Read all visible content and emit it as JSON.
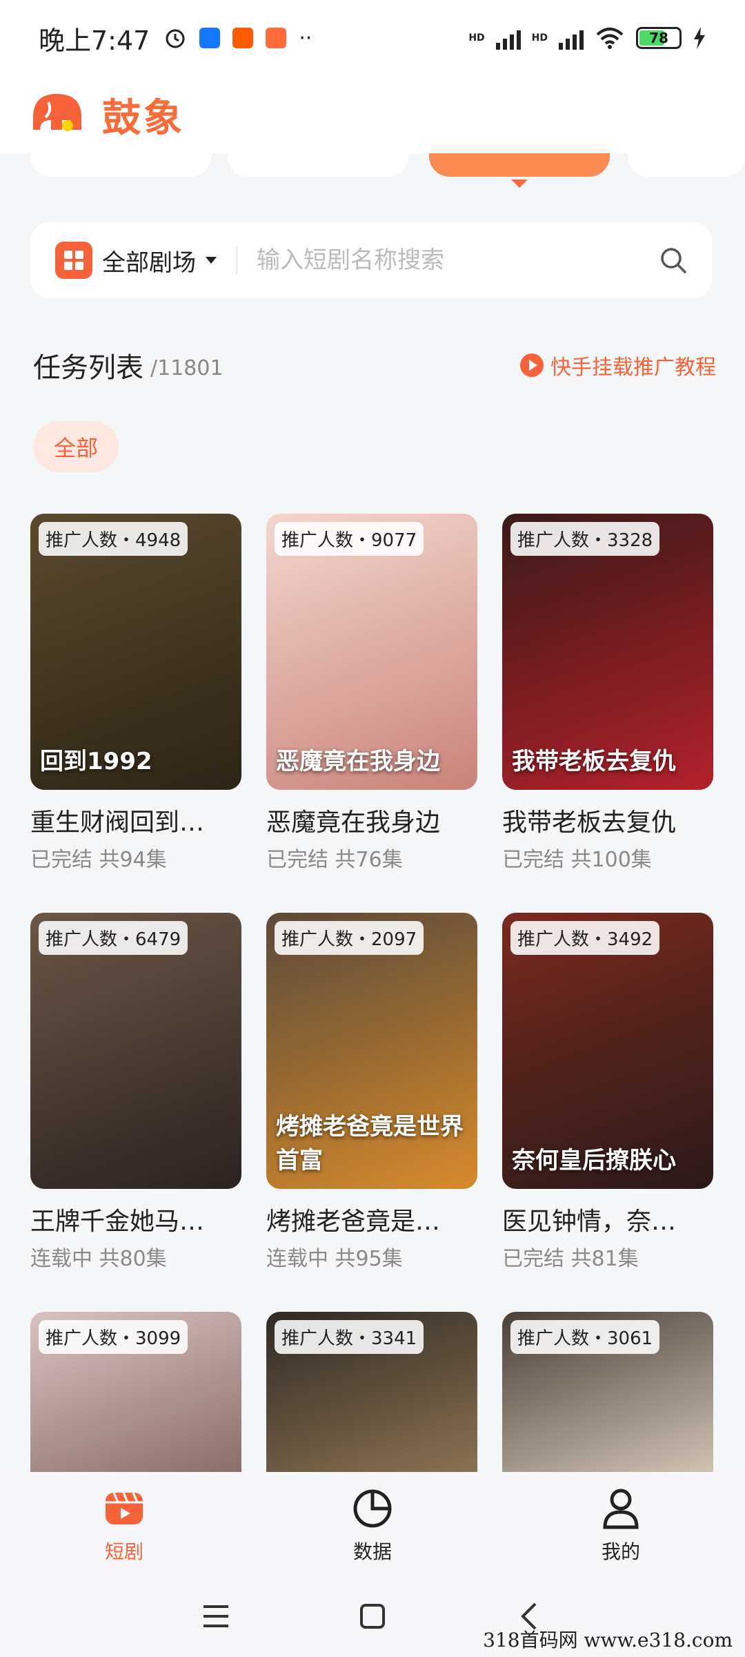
{
  "status_bar": {
    "time": "晚上7:47",
    "battery": "78",
    "net_1": "HD",
    "net_2": "HD"
  },
  "app": {
    "name": "鼓象",
    "accent": "#f6623a"
  },
  "search": {
    "theater_label": "全部剧场",
    "placeholder": "输入短剧名称搜索"
  },
  "task_list": {
    "title": "任务列表",
    "count": "/11801",
    "tutorial": "快手挂载推广教程"
  },
  "filter": {
    "chip": "全部"
  },
  "cards": [
    {
      "badge": "推广人数・4948",
      "title": "重生财阀回到…",
      "sub": "已完结 共94集",
      "poster_text": "回到1992",
      "color1": "#5a4a2e",
      "color2": "#2c2417"
    },
    {
      "badge": "推广人数・9077",
      "title": "恶魔竟在我身边",
      "sub": "已完结 共76集",
      "poster_text": "恶魔竟在我身边",
      "color1": "#f3d6cf",
      "color2": "#c9837a"
    },
    {
      "badge": "推广人数・3328",
      "title": "我带老板去复仇",
      "sub": "已完结 共100集",
      "poster_text": "我带老板去复仇",
      "color1": "#3a1b1b",
      "color2": "#b3202a"
    },
    {
      "badge": "推广人数・6479",
      "title": "王牌千金她马…",
      "sub": "连载中 共80集",
      "poster_text": "",
      "color1": "#6a5748",
      "color2": "#2b2220"
    },
    {
      "badge": "推广人数・2097",
      "title": "烤摊老爸竟是…",
      "sub": "连载中 共95集",
      "poster_text": "烤摊老爸竟是世界首富",
      "color1": "#5b4a3a",
      "color2": "#d68a2a"
    },
    {
      "badge": "推广人数・3492",
      "title": "医见钟情，奈…",
      "sub": "已完结 共81集",
      "poster_text": "奈何皇后撩朕心",
      "color1": "#7a2a20",
      "color2": "#2a1a1a"
    },
    {
      "badge": "推广人数・3099",
      "title": "",
      "sub": "",
      "poster_text": "",
      "color1": "#d8c2c2",
      "color2": "#8a6f6a"
    },
    {
      "badge": "推广人数・3341",
      "title": "",
      "sub": "",
      "poster_text": "",
      "color1": "#2f2a27",
      "color2": "#8a7350"
    },
    {
      "badge": "推广人数・3061",
      "title": "",
      "sub": "",
      "poster_text": "",
      "color1": "#4a3f38",
      "color2": "#cfc3b5"
    }
  ],
  "bottom_nav": [
    {
      "label": "短剧",
      "icon": "clapperboard-icon",
      "active": true
    },
    {
      "label": "数据",
      "icon": "pie-chart-icon",
      "active": false
    },
    {
      "label": "我的",
      "icon": "user-icon",
      "active": false
    }
  ],
  "watermark": "318首码网 www.e318.com"
}
